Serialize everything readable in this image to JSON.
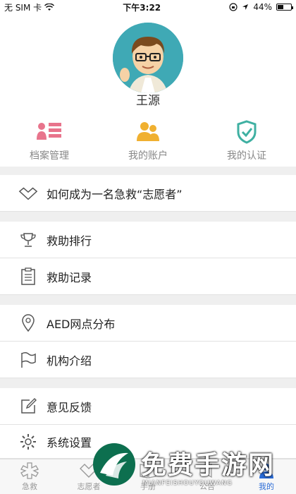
{
  "status_bar": {
    "carrier": "无 SIM 卡",
    "time": "下午3:22",
    "battery": "44%",
    "battery_level": 0.44
  },
  "profile": {
    "name": "王源"
  },
  "quick_actions": [
    {
      "label": "档案管理",
      "icon": "archive-icon",
      "color": "#e8748c"
    },
    {
      "label": "我的账户",
      "icon": "people-icon",
      "color": "#f0b030"
    },
    {
      "label": "我的认证",
      "icon": "shield-check-icon",
      "color": "#3fb0a2"
    }
  ],
  "menu": {
    "volunteer": "如何成为一名急救“志愿者”",
    "ranking": "救助排行",
    "records": "救助记录",
    "aed": "AED网点分布",
    "org": "机构介绍",
    "feedback": "意见反馈",
    "settings": "系统设置"
  },
  "tabbar": [
    {
      "label": "急救",
      "icon": "medical-star-icon"
    },
    {
      "label": "志愿者",
      "icon": "heart-hands-icon"
    },
    {
      "label": "手册",
      "icon": "book-icon"
    },
    {
      "label": "公告",
      "icon": "megaphone-icon"
    },
    {
      "label": "我的",
      "icon": "person-icon",
      "active": true
    }
  ],
  "watermark": {
    "text": "免费手游网",
    "sub": "MIANFEISHOUYOUWANG"
  },
  "colors": {
    "accent": "#2a6bd6",
    "section_gap": "#efefef"
  }
}
